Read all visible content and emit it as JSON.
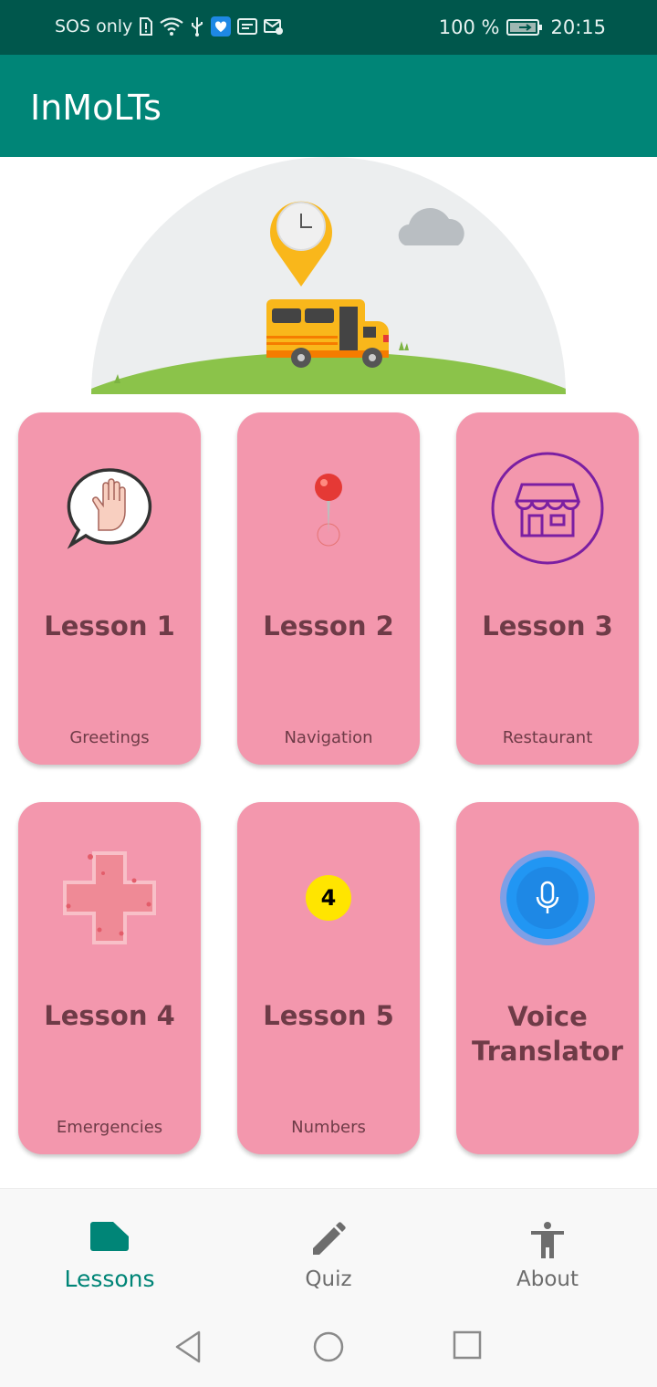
{
  "status_bar": {
    "carrier": "SOS only",
    "battery": "100 %",
    "time": "20:15"
  },
  "app_bar": {
    "title": "InMoLTs"
  },
  "lessons": [
    {
      "title": "Lesson 1",
      "subtitle": "Greetings",
      "icon": "waving-hand-bubble-icon"
    },
    {
      "title": "Lesson 2",
      "subtitle": "Navigation",
      "icon": "map-pin-icon"
    },
    {
      "title": "Lesson 3",
      "subtitle": "Restaurant",
      "icon": "store-icon"
    },
    {
      "title": "Lesson 4",
      "subtitle": "Emergencies",
      "icon": "medical-cross-icon"
    },
    {
      "title": "Lesson 5",
      "subtitle": "Numbers",
      "icon": "number-badge-icon",
      "badge": "4"
    },
    {
      "title": "Voice Translator",
      "subtitle": "",
      "icon": "microphone-icon"
    }
  ],
  "bottom_nav": {
    "items": [
      {
        "label": "Lessons",
        "icon": "label-icon",
        "active": true
      },
      {
        "label": "Quiz",
        "icon": "pencil-icon",
        "active": false
      },
      {
        "label": "About",
        "icon": "accessibility-icon",
        "active": false
      }
    ]
  },
  "colors": {
    "status_bar": "#00574c",
    "app_bar": "#008577",
    "card": "#f397ad",
    "card_text": "#6e3b47",
    "nav_active": "#008577",
    "nav_inactive": "#6d6d6d"
  }
}
